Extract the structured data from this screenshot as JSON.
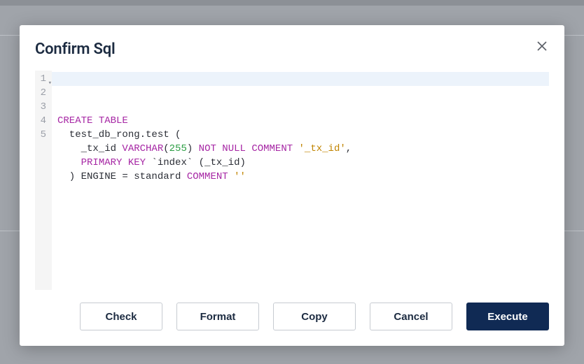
{
  "modal": {
    "title": "Confirm Sql"
  },
  "editor": {
    "line_numbers": [
      "1",
      "2",
      "3",
      "4",
      "5"
    ],
    "tokens": [
      [
        {
          "t": "CREATE",
          "c": "kw"
        },
        {
          "t": " "
        },
        {
          "t": "TABLE",
          "c": "kw"
        }
      ],
      [
        {
          "t": "  test_db_rong.test ("
        }
      ],
      [
        {
          "t": "    _tx_id "
        },
        {
          "t": "VARCHAR",
          "c": "kw"
        },
        {
          "t": "("
        },
        {
          "t": "255",
          "c": "num"
        },
        {
          "t": ") "
        },
        {
          "t": "NOT",
          "c": "kw"
        },
        {
          "t": " "
        },
        {
          "t": "NULL",
          "c": "kw"
        },
        {
          "t": " "
        },
        {
          "t": "COMMENT",
          "c": "kw"
        },
        {
          "t": " "
        },
        {
          "t": "'_tx_id'",
          "c": "str"
        },
        {
          "t": ","
        }
      ],
      [
        {
          "t": "    "
        },
        {
          "t": "PRIMARY",
          "c": "kw"
        },
        {
          "t": " "
        },
        {
          "t": "KEY",
          "c": "kw"
        },
        {
          "t": " `index` (_tx_id)"
        }
      ],
      [
        {
          "t": "  ) ENGINE = standard "
        },
        {
          "t": "COMMENT",
          "c": "kw"
        },
        {
          "t": " "
        },
        {
          "t": "''",
          "c": "str"
        }
      ]
    ]
  },
  "buttons": {
    "check": "Check",
    "format": "Format",
    "copy": "Copy",
    "cancel": "Cancel",
    "execute": "Execute"
  }
}
